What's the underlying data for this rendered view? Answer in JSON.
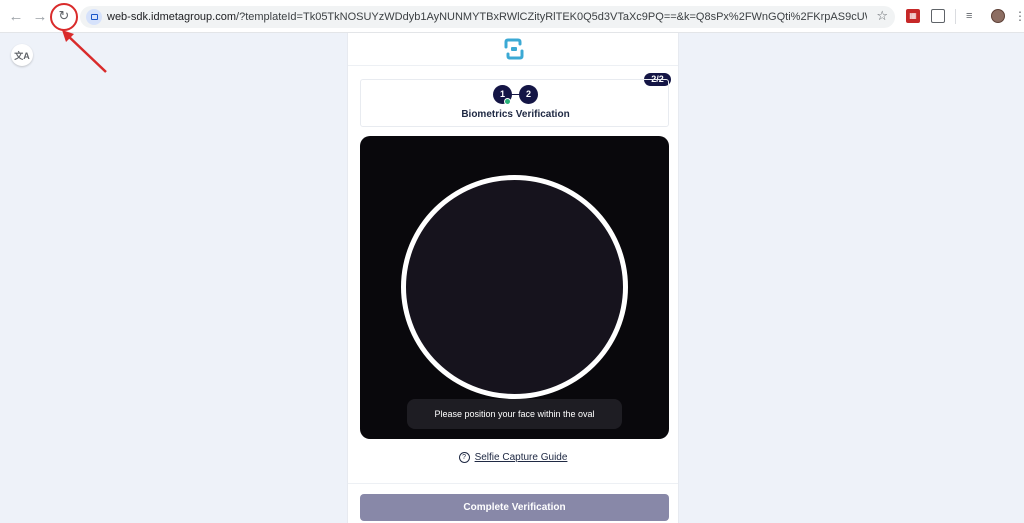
{
  "browser": {
    "url_host": "web-sdk.idmetagroup.com",
    "url_rest": "/?templateId=Tk05TkNOSUYzWDdyb1AyNUNMYTBxRWlCZityRlTEK0Q5d3VTaXc9PQ==&k=Q8sPx%2FWnGQti%2FKrpAS9cUWBiJKP16v2vma0mQWO0K...",
    "back_icon": "arrow-left-icon",
    "forward_icon": "arrow-right-icon",
    "reload_icon": "reload-icon",
    "bookmark_icon": "star-icon",
    "extensions": [
      "red-extension-icon",
      "puzzle-icon",
      "media-icon",
      "profile-avatar",
      "menu-icon"
    ],
    "translate_icon": "translate-icon",
    "annotation_color": "#d92b2b"
  },
  "page": {
    "step_badge": "2/2",
    "steps": [
      "1",
      "2"
    ],
    "step_title": "Biometrics Verification",
    "camera_hint": "Please position your face within the oval",
    "guide_label": "Selfie Capture Guide",
    "button_label": "Complete Verification",
    "accent_color": "#141545",
    "logo_color": "#3ba9d4"
  }
}
